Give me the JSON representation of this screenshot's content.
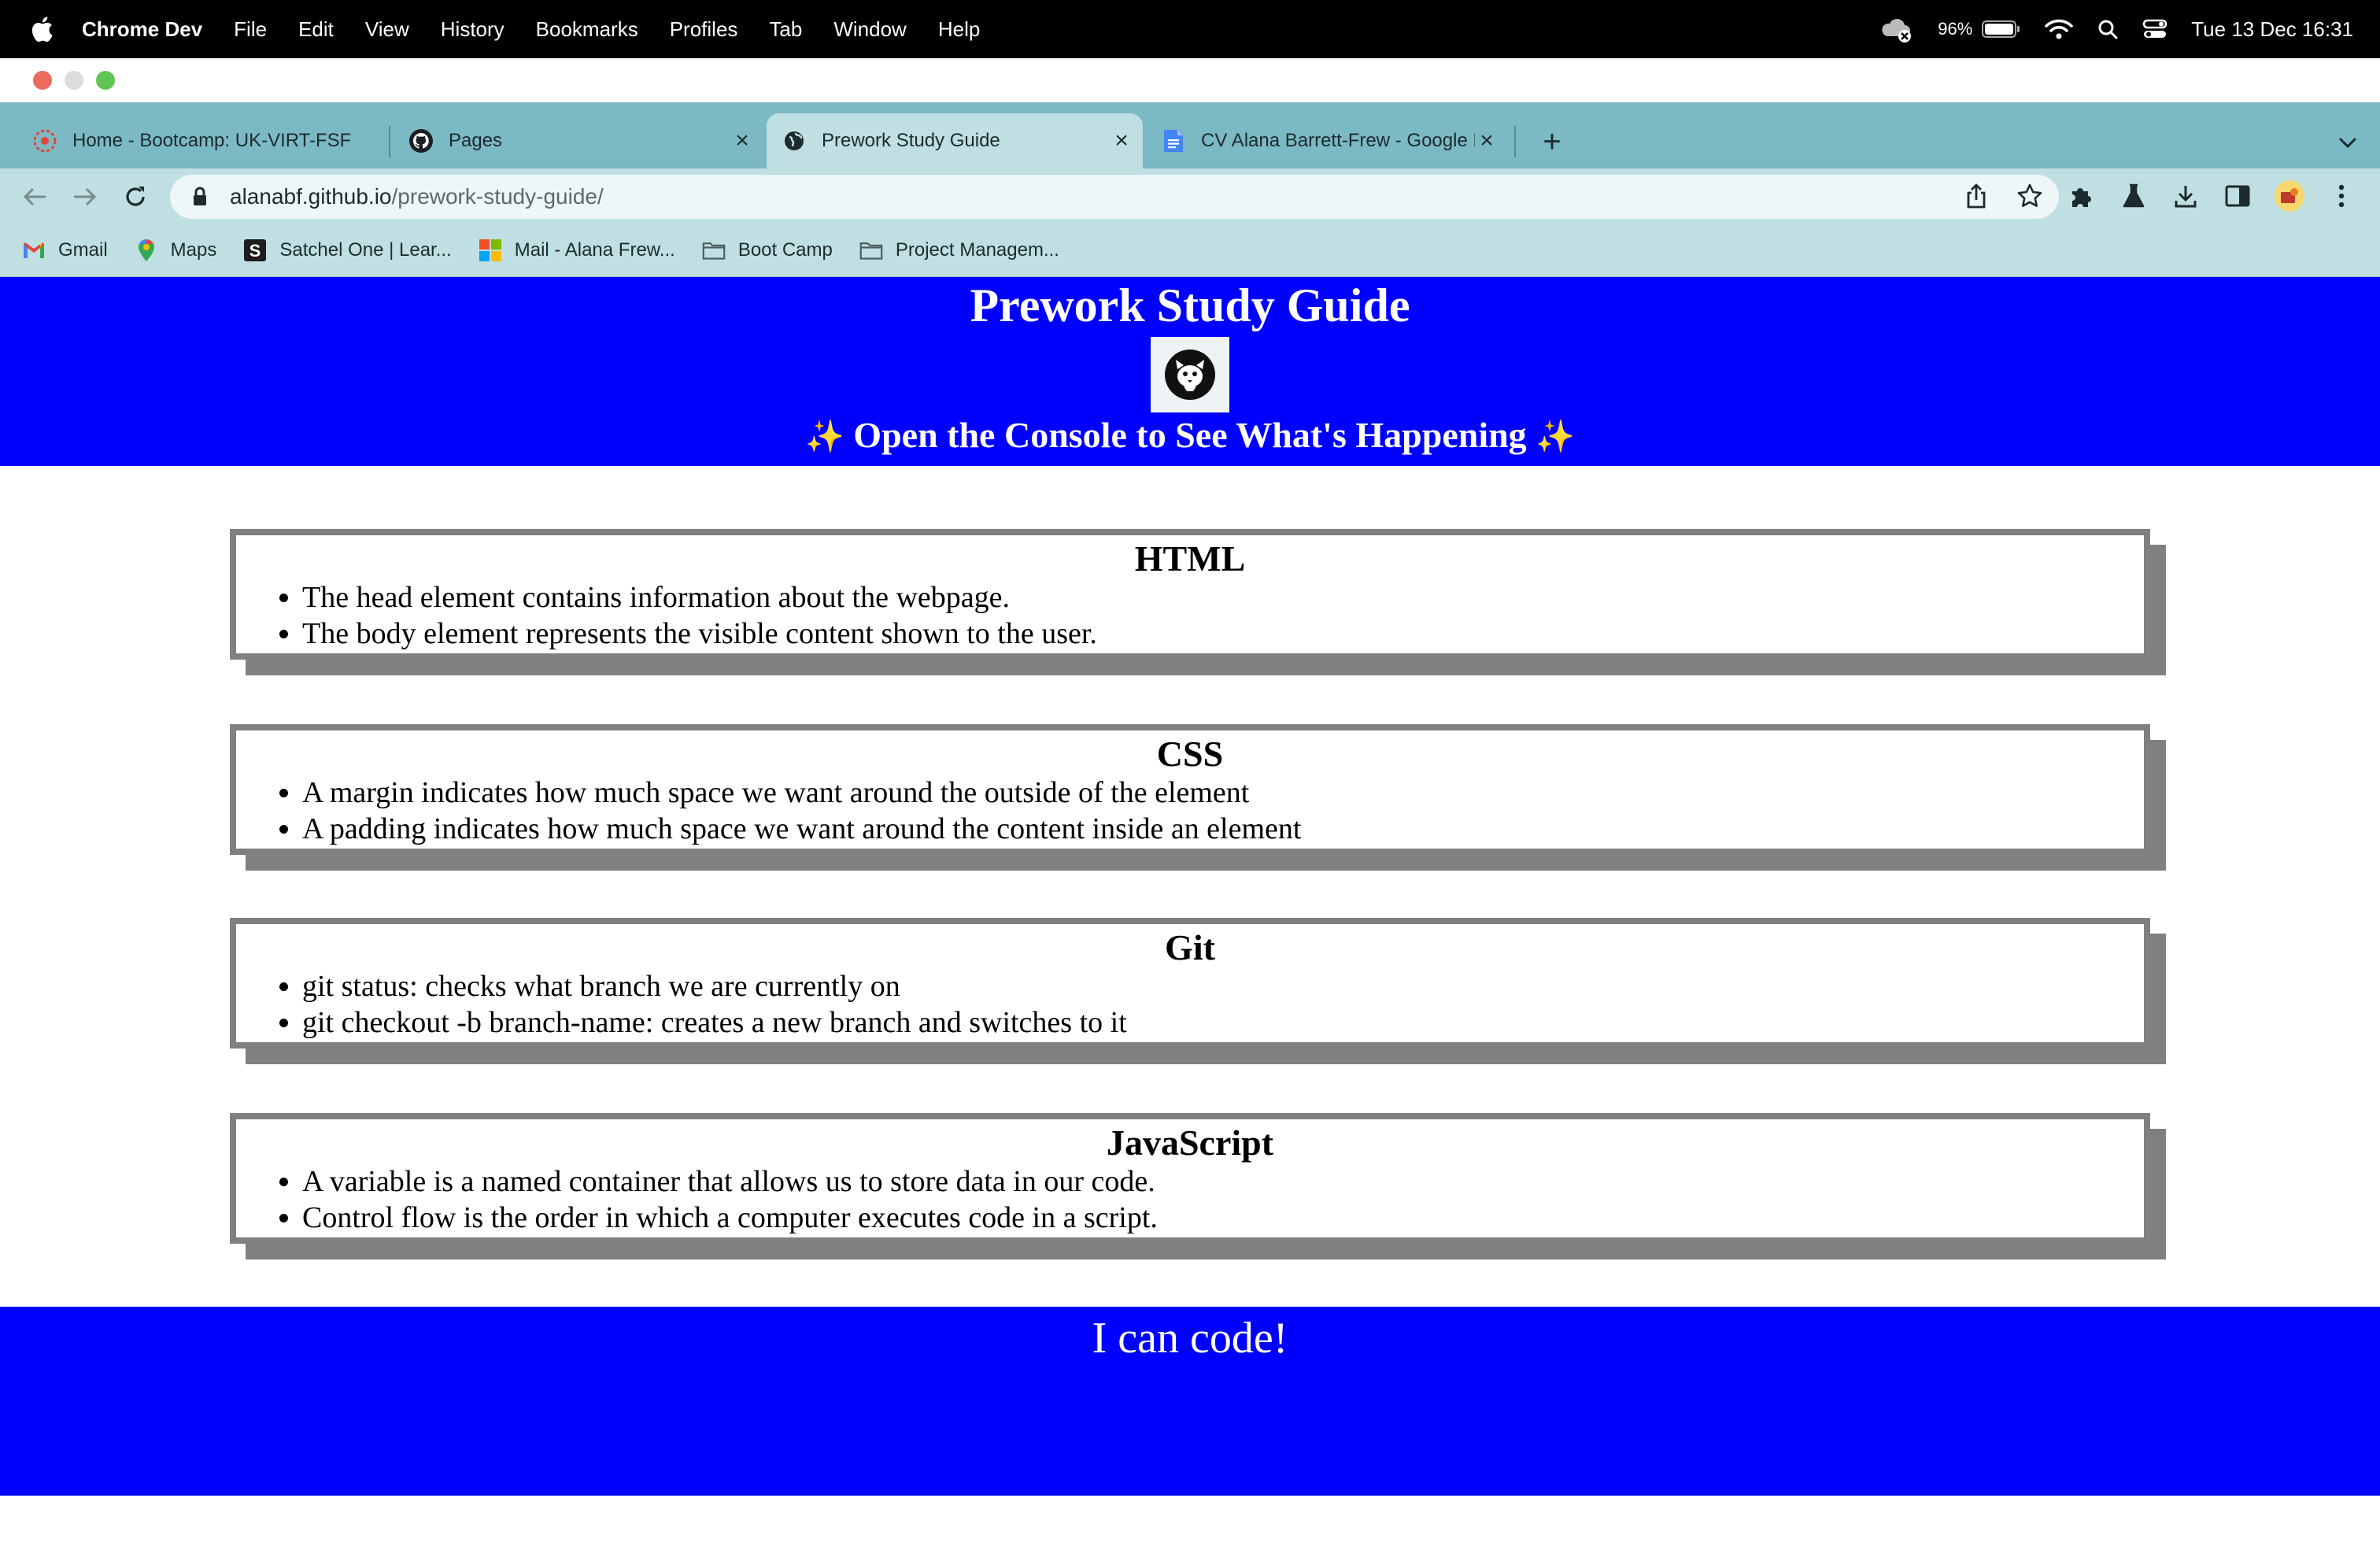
{
  "menubar": {
    "app_name": "Chrome Dev",
    "items": [
      "File",
      "Edit",
      "View",
      "History",
      "Bookmarks",
      "Profiles",
      "Tab",
      "Window",
      "Help"
    ],
    "battery": "96%",
    "clock": "Tue 13 Dec  16:31"
  },
  "tabs": [
    {
      "title": "Home - Bootcamp: UK-VIRT-FSF",
      "icon": "bootcamp-icon",
      "active": false
    },
    {
      "title": "Pages",
      "icon": "github-icon",
      "active": false
    },
    {
      "title": "Prework Study Guide",
      "icon": "globe-icon",
      "active": true
    },
    {
      "title": "CV Alana Barrett-Frew - Google Docs",
      "icon": "google-docs-icon",
      "active": false
    }
  ],
  "address": {
    "host": "alanabf.github.io",
    "path": "/prework-study-guide/"
  },
  "bookmarks": [
    {
      "label": "Gmail",
      "icon": "gmail-icon"
    },
    {
      "label": "Maps",
      "icon": "maps-icon"
    },
    {
      "label": "Satchel One | Lear...",
      "icon": "satchel-icon"
    },
    {
      "label": "Mail - Alana Frew...",
      "icon": "microsoft-icon"
    },
    {
      "label": "Boot Camp",
      "icon": "folder-icon"
    },
    {
      "label": "Project Managem...",
      "icon": "folder-icon"
    }
  ],
  "page": {
    "title": "Prework Study Guide",
    "subtitle": "Open the Console to See What's Happening",
    "sparkle": "✨",
    "sections": [
      {
        "heading": "HTML",
        "items": [
          "The head element contains information about the webpage.",
          "The body element represents the visible content shown to the user."
        ]
      },
      {
        "heading": "CSS",
        "items": [
          "A margin indicates how much space we want around the outside of the element",
          "A padding indicates how much space we want around the content inside an element"
        ]
      },
      {
        "heading": "Git",
        "items": [
          "git status: checks what branch we are currently on",
          "git checkout -b branch-name: creates a new branch and switches to it"
        ]
      },
      {
        "heading": "JavaScript",
        "items": [
          "A variable is a named container that allows us to store data in our code.",
          "Control flow is the order in which a computer executes code in a script."
        ]
      }
    ],
    "footer": "I can code!"
  },
  "colors": {
    "hero_bg": "#0000ff",
    "card_border": "#808080",
    "tab_strip": "#7bb9c4",
    "toolbar": "#bfdfe3"
  }
}
